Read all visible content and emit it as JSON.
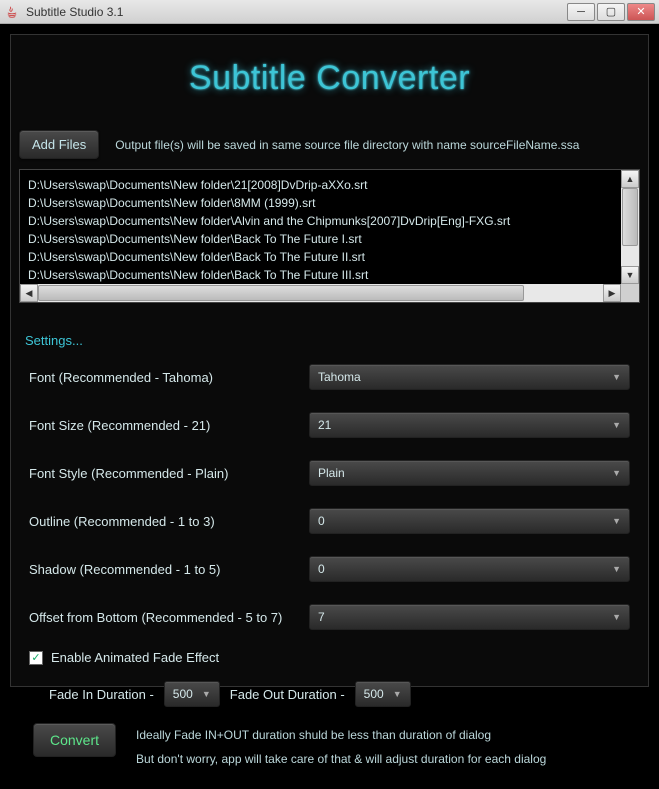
{
  "window": {
    "title": "Subtitle Studio 3.1"
  },
  "header": {
    "app_title": "Subtitle Converter"
  },
  "toolbar": {
    "add_files": "Add Files",
    "output_hint": "Output file(s) will be saved in same source file directory with name sourceFileName.ssa"
  },
  "files": [
    "D:\\Users\\swap\\Documents\\New folder\\21[2008]DvDrip-aXXo.srt",
    "D:\\Users\\swap\\Documents\\New folder\\8MM (1999).srt",
    "D:\\Users\\swap\\Documents\\New folder\\Alvin and the Chipmunks[2007]DvDrip[Eng]-FXG.srt",
    "D:\\Users\\swap\\Documents\\New folder\\Back To The Future I.srt",
    "D:\\Users\\swap\\Documents\\New folder\\Back To The Future II.srt",
    "D:\\Users\\swap\\Documents\\New folder\\Back To The Future III.srt"
  ],
  "settings": {
    "title": "Settings...",
    "font": {
      "label": "Font     (Recommended - Tahoma)",
      "value": "Tahoma"
    },
    "font_size": {
      "label": "Font Size (Recommended - 21)",
      "value": "21"
    },
    "font_style": {
      "label": "Font Style (Recommended - Plain)",
      "value": "Plain"
    },
    "outline": {
      "label": "Outline    (Recommended - 1 to 3)",
      "value": "0"
    },
    "shadow": {
      "label": "Shadow   (Recommended - 1 to 5)",
      "value": "0"
    },
    "offset": {
      "label": "Offset from Bottom   (Recommended - 5 to 7)",
      "value": "7"
    },
    "fade": {
      "enable_label": "Enable Animated Fade Effect",
      "enabled": true,
      "in_label": "Fade In Duration -",
      "in_value": "500",
      "out_label": "Fade Out Duration -",
      "out_value": "500",
      "hint1": "Ideally Fade IN+OUT duration shuld be less than duration of dialog",
      "hint2": "But don't worry, app will take care of that & will adjust duration for each dialog"
    }
  },
  "actions": {
    "convert": "Convert"
  }
}
